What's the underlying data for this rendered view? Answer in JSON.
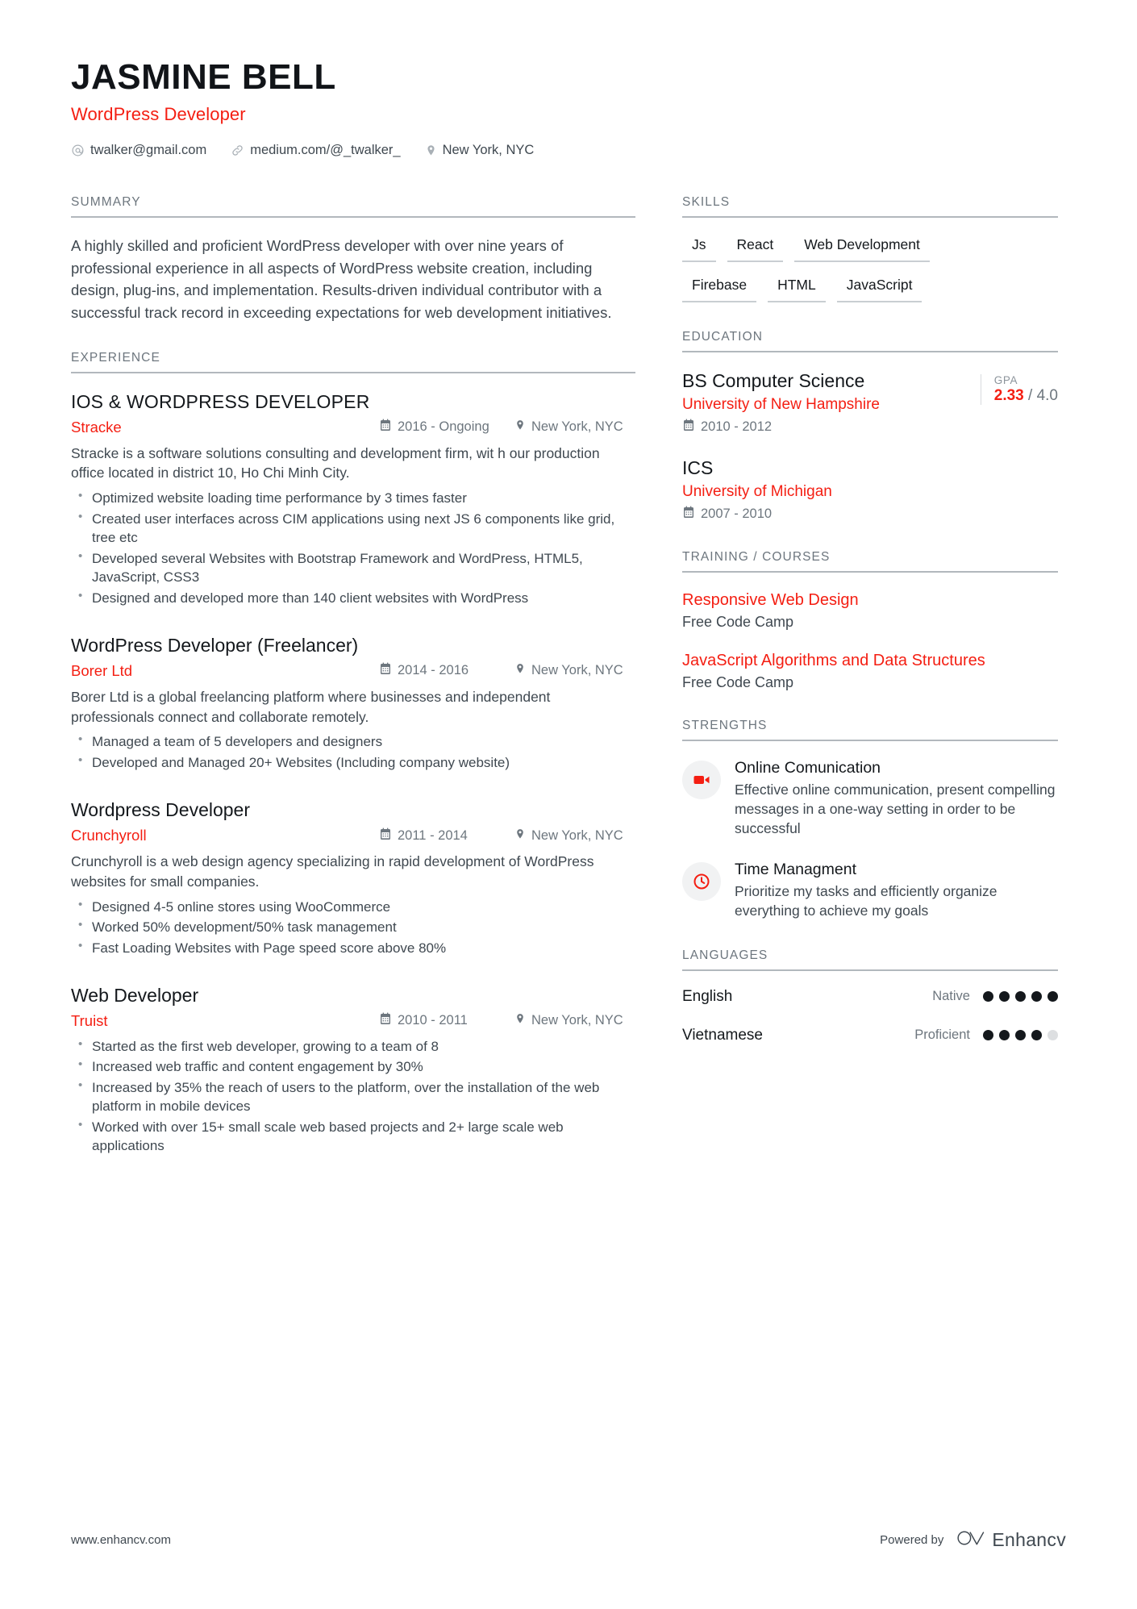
{
  "header": {
    "name": "JASMINE BELL",
    "role": "WordPress Developer",
    "contacts": [
      {
        "icon": "email-icon",
        "text": "twalker@gmail.com"
      },
      {
        "icon": "link-icon",
        "text": "medium.com/@_twalker_"
      },
      {
        "icon": "location-pin-icon",
        "text": "New York, NYC"
      }
    ]
  },
  "summary": {
    "title": "SUMMARY",
    "text": "A highly skilled and proficient WordPress developer with over nine years of professional experience in all aspects of WordPress website creation, including design, plug-ins, and implementation. Results-driven individual contributor with a successful track record in exceeding expectations for web development initiatives."
  },
  "experience": {
    "title": "EXPERIENCE",
    "entries": [
      {
        "title": "IOS & WORDPRESS DEVELOPER",
        "company": "Stracke",
        "date": "2016 - Ongoing",
        "location": "New York, NYC",
        "description": "Stracke is a software solutions consulting and development firm, wit h our production office located in district 10, Ho Chi Minh City.",
        "bullets": [
          "Optimized website loading time performance by 3 times faster",
          "Created user interfaces across CIM applications using next JS 6 components like grid, tree etc",
          "Developed several Websites with Bootstrap Framework and WordPress, HTML5, JavaScript, CSS3",
          "Designed and developed more than 140 client websites with WordPress"
        ]
      },
      {
        "title": "WordPress Developer (Freelancer)",
        "company": "Borer Ltd",
        "date": "2014 - 2016",
        "location": "New York, NYC",
        "description": "Borer Ltd is a global freelancing platform where businesses and independent professionals connect and collaborate remotely.",
        "bullets": [
          "Managed a team of 5 developers and designers",
          "Developed and Managed 20+ Websites (Including company website)"
        ]
      },
      {
        "title": "Wordpress Developer",
        "company": "Crunchyroll",
        "date": "2011 - 2014",
        "location": "New York, NYC",
        "description": "Crunchyroll is a web design agency specializing in rapid development of WordPress websites for small companies.",
        "bullets": [
          "Designed 4-5 online stores using WooCommerce",
          "Worked 50% development/50% task management",
          "Fast Loading Websites with Page speed score above 80%"
        ]
      },
      {
        "title": "Web Developer",
        "company": "Truist",
        "date": "2010 - 2011",
        "location": "New York, NYC",
        "description": "",
        "bullets": [
          "Started as the first web developer, growing to a team of 8",
          "Increased web traffic and content engagement by 30%",
          "Increased by 35% the reach of users to the platform, over the installation of the web platform in mobile devices",
          "Worked with over 15+ small scale web based projects and 2+ large scale web applications"
        ]
      }
    ]
  },
  "skills": {
    "title": "SKILLS",
    "rows": [
      [
        "Js",
        "React",
        "Web Development"
      ],
      [
        "Firebase",
        "HTML",
        "JavaScript"
      ]
    ]
  },
  "education": {
    "title": "EDUCATION",
    "entries": [
      {
        "degree": "BS Computer Science",
        "school": "University of New Hampshire",
        "date": "2010 - 2012",
        "gpa_label": "GPA",
        "gpa_value": "2.33",
        "gpa_scale": "/ 4.0"
      },
      {
        "degree": "ICS",
        "school": "University of Michigan",
        "date": "2007 - 2010",
        "gpa_label": "",
        "gpa_value": "",
        "gpa_scale": ""
      }
    ]
  },
  "training": {
    "title": "TRAINING / COURSES",
    "entries": [
      {
        "name": "Responsive Web Design",
        "provider": "Free Code Camp"
      },
      {
        "name": "JavaScript Algorithms and Data Structures",
        "provider": "Free Code Camp"
      }
    ]
  },
  "strengths": {
    "title": "STRENGTHS",
    "entries": [
      {
        "icon": "video-camera-icon",
        "name": "Online Comunication",
        "description": "Effective online communication, present compelling messages in a one-way setting in order to be successful"
      },
      {
        "icon": "clock-icon",
        "name": "Time Managment",
        "description": "Prioritize my tasks and efficiently organize everything to achieve my goals"
      }
    ]
  },
  "languages": {
    "title": "LANGUAGES",
    "entries": [
      {
        "name": "English",
        "level": "Native",
        "filled": 5,
        "total": 5
      },
      {
        "name": "Vietnamese",
        "level": "Proficient",
        "filled": 4,
        "total": 5
      }
    ]
  },
  "footer": {
    "url": "www.enhancv.com",
    "powered_by": "Powered by",
    "brand": "Enhancv"
  },
  "colors": {
    "accent": "#f41e12",
    "text": "#3f4850",
    "heading": "#14181c",
    "muted": "#6d767e",
    "rule": "#b2b8bd"
  }
}
